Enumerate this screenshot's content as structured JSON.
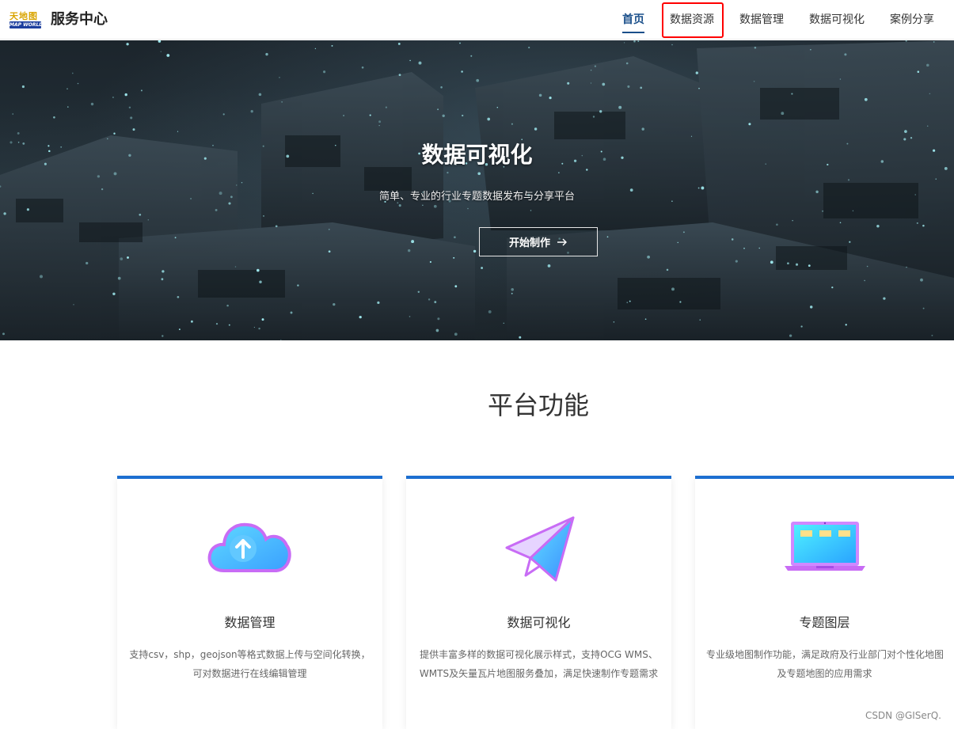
{
  "header": {
    "logo_cn": "天地图",
    "logo_en": "MAP WORLD",
    "site_title": "服务中心",
    "nav": [
      {
        "label": "首页",
        "active": true
      },
      {
        "label": "数据资源",
        "active": false,
        "highlighted": true
      },
      {
        "label": "数据管理",
        "active": false
      },
      {
        "label": "数据可视化",
        "active": false
      },
      {
        "label": "案例分享",
        "active": false
      }
    ]
  },
  "hero": {
    "title": "数据可视化",
    "subtitle": "简单、专业的行业专题数据发布与分享平台",
    "cta_label": "开始制作"
  },
  "features": {
    "title": "平台功能",
    "cards": [
      {
        "icon": "cloud-upload-icon",
        "title": "数据管理",
        "desc_lines": [
          "支持csv，shp，geojson等格式数据上传与空间化转换，",
          "可对数据进行在线编辑管理"
        ]
      },
      {
        "icon": "paper-plane-icon",
        "title": "数据可视化",
        "desc_lines": [
          "提供丰富多样的数据可视化展示样式，支持OCG WMS、",
          "WMTS及矢量瓦片地图服务叠加，满足快速制作专题需求"
        ]
      },
      {
        "icon": "laptop-icon",
        "title": "专题图层",
        "desc_lines": [
          "专业级地图制作功能，满足政府及行业部门对个性化地图",
          "及专题地图的应用需求"
        ]
      }
    ]
  },
  "colors": {
    "accent": "#1c6ed0",
    "nav_active": "#1a4f8a",
    "highlight_box": "#ff0000"
  },
  "watermark": "CSDN @GISerQ."
}
